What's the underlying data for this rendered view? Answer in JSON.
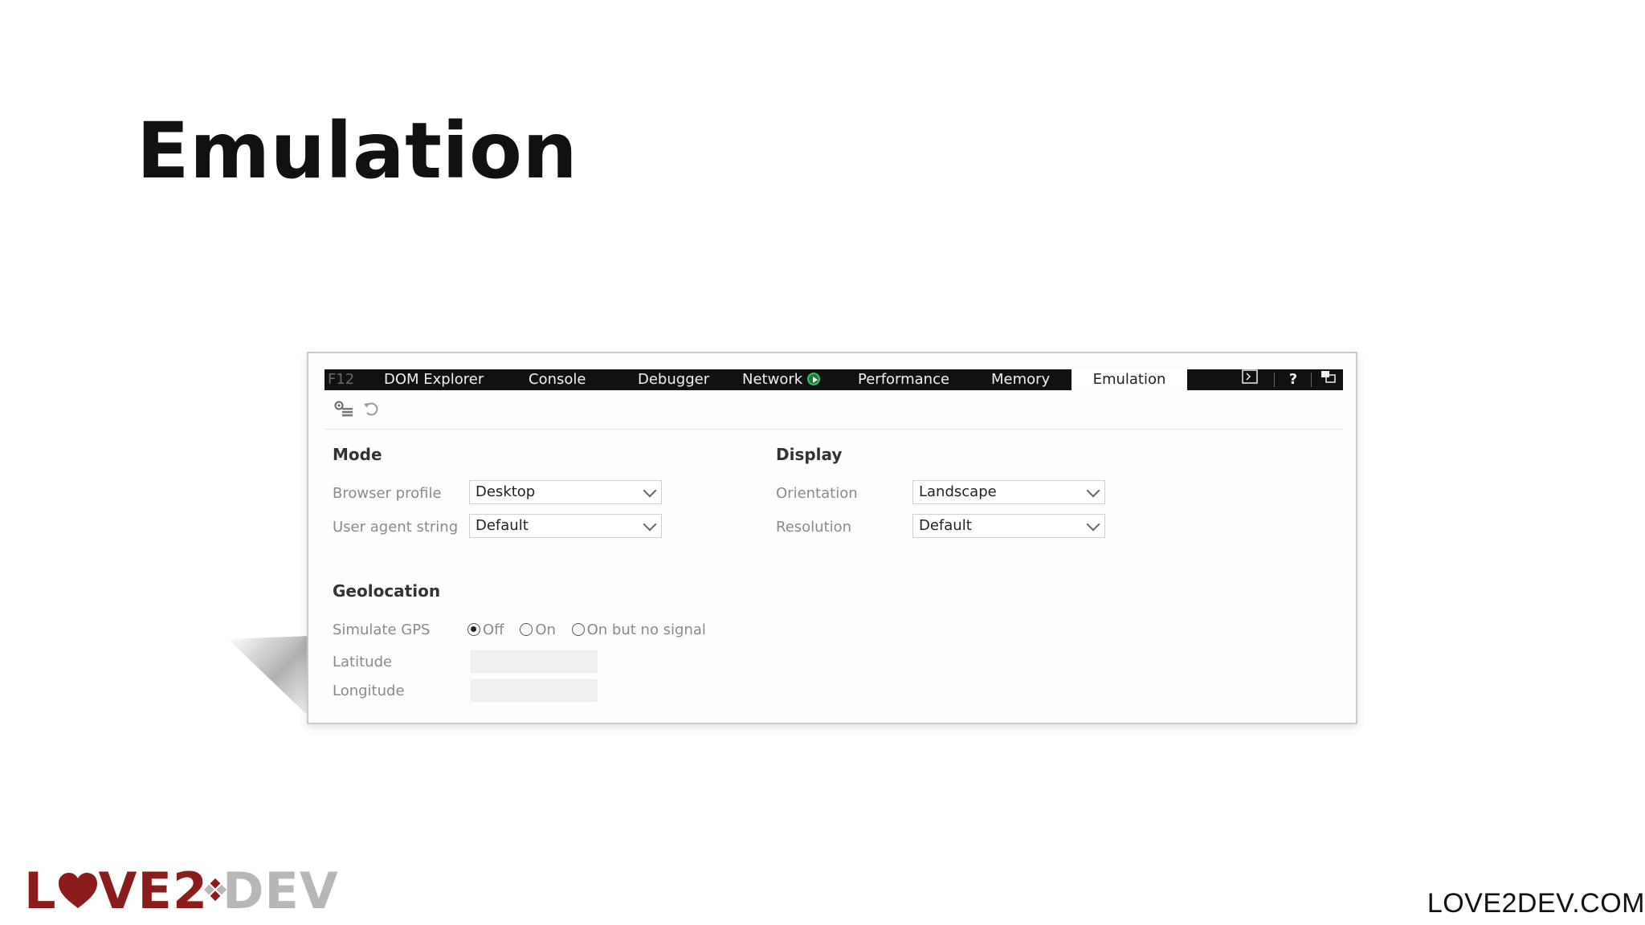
{
  "slide": {
    "title": "Emulation",
    "site_url": "LOVE2DEV.COM",
    "logo": {
      "part1": "L",
      "part2": "VE2",
      "part3": "DEV",
      "brand_color": "#8a1c1c",
      "gray_color": "#b7b7b7"
    }
  },
  "devtools": {
    "tabs": [
      {
        "label": "F12"
      },
      {
        "label": "DOM Explorer"
      },
      {
        "label": "Console"
      },
      {
        "label": "Debugger"
      },
      {
        "label": "Network"
      },
      {
        "label": "Performance"
      },
      {
        "label": "Memory"
      },
      {
        "label": "Emulation",
        "active": true
      }
    ],
    "toolbar_icons": [
      "console-icon",
      "help-icon",
      "undock-icon"
    ],
    "help_glyph": "?",
    "tools": [
      "settings-icon",
      "reset-icon"
    ],
    "mode": {
      "title": "Mode",
      "browser_profile": {
        "label": "Browser profile",
        "value": "Desktop"
      },
      "user_agent": {
        "label": "User agent string",
        "value": "Default"
      }
    },
    "display": {
      "title": "Display",
      "orientation": {
        "label": "Orientation",
        "value": "Landscape"
      },
      "resolution": {
        "label": "Resolution",
        "value": "Default"
      }
    },
    "geolocation": {
      "title": "Geolocation",
      "simulate_gps": {
        "label": "Simulate GPS",
        "options": [
          "Off",
          "On",
          "On but no signal"
        ],
        "selected": "Off"
      },
      "latitude": {
        "label": "Latitude",
        "value": ""
      },
      "longitude": {
        "label": "Longitude",
        "value": ""
      }
    }
  }
}
